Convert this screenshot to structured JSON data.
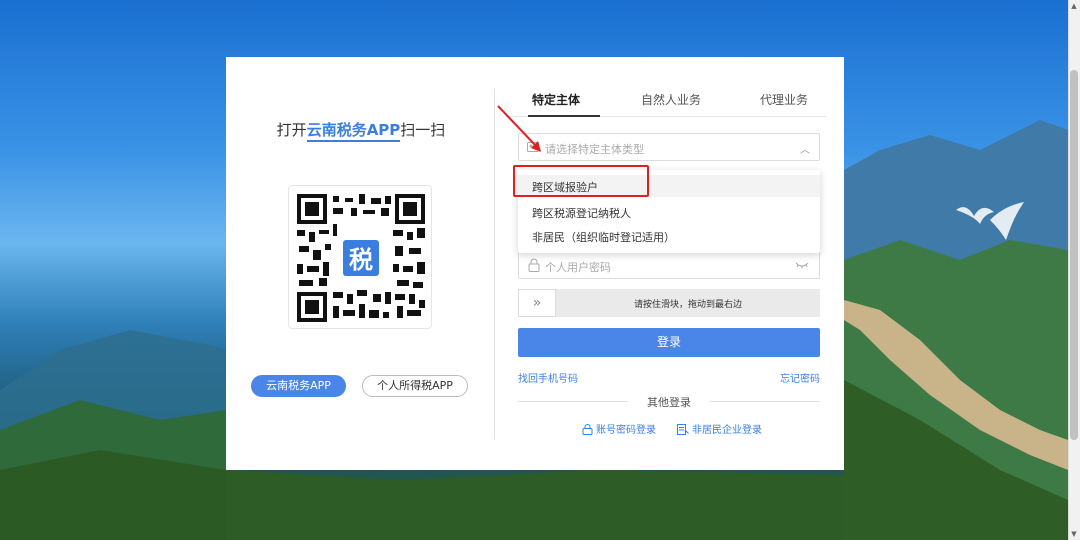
{
  "qr": {
    "title_prefix": "打开",
    "title_highlight": "云南税务APP",
    "title_suffix": "扫一扫",
    "logo_char": "税"
  },
  "app_buttons": {
    "yunnan_tax": "云南税务APP",
    "personal_tax": "个人所得税APP"
  },
  "tabs": [
    {
      "label": "特定主体",
      "active": true
    },
    {
      "label": "自然人业务",
      "active": false
    },
    {
      "label": "代理业务",
      "active": false
    }
  ],
  "entity_select": {
    "placeholder": "请选择特定主体类型"
  },
  "dropdown_options": [
    "跨区域报验户",
    "跨区税源登记纳税人",
    "非居民（组织临时登记适用）"
  ],
  "password": {
    "placeholder": "个人用户密码"
  },
  "slider": {
    "handle": "»",
    "hint": "请按住滑块，拖动到最右边"
  },
  "login_button": "登录",
  "links": {
    "find_phone": "找回手机号码",
    "forgot_password": "忘记密码"
  },
  "other_login": {
    "label": "其他登录",
    "account_password": "账号密码登录",
    "nonresident_enterprise": "非居民企业登录"
  },
  "colors": {
    "accent": "#4a86e8",
    "link": "#3a7fe0",
    "annotation": "#e02020"
  }
}
